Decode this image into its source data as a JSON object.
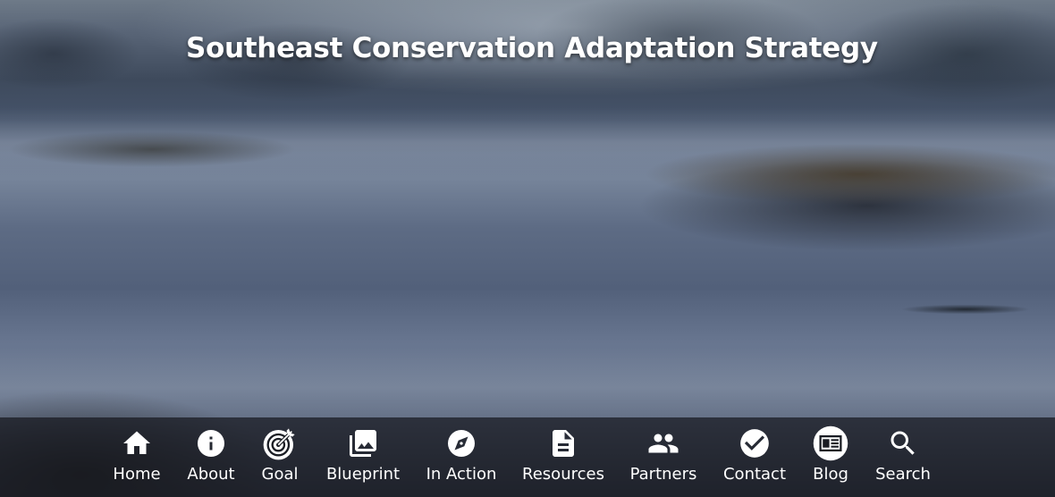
{
  "site": {
    "title": "Southeast Conservation Adaptation Strategy"
  },
  "nav": {
    "items": [
      {
        "label": "Home",
        "icon": "home-icon"
      },
      {
        "label": "About",
        "icon": "info-icon"
      },
      {
        "label": "Goal",
        "icon": "target-icon"
      },
      {
        "label": "Blueprint",
        "icon": "photo-library-icon"
      },
      {
        "label": "In Action",
        "icon": "compass-icon"
      },
      {
        "label": "Resources",
        "icon": "document-icon"
      },
      {
        "label": "Partners",
        "icon": "people-icon"
      },
      {
        "label": "Contact",
        "icon": "check-circle-icon"
      },
      {
        "label": "Blog",
        "icon": "newspaper-icon"
      },
      {
        "label": "Search",
        "icon": "search-icon"
      }
    ]
  },
  "colors": {
    "text": "#ffffff",
    "nav_background": "#16181e"
  }
}
